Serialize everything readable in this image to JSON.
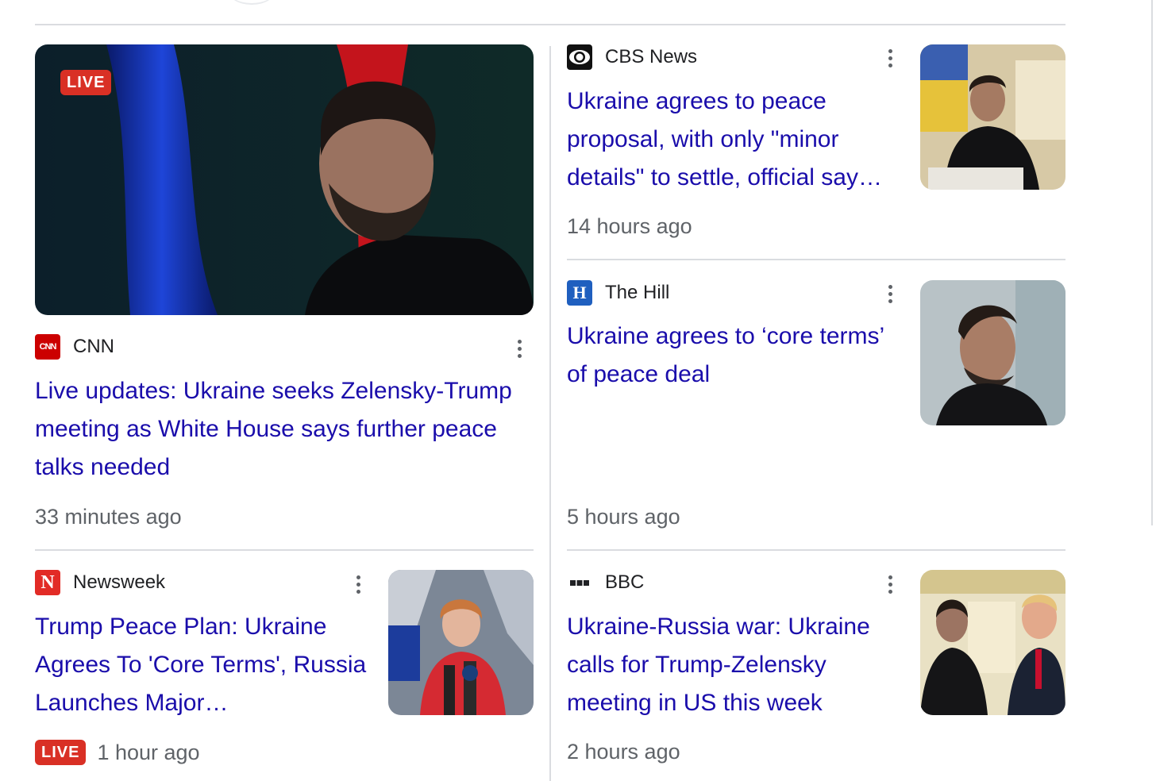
{
  "badges": {
    "live": "LIVE"
  },
  "colors": {
    "link": "#1a0dab",
    "meta": "#5f6368",
    "live": "#d93025",
    "divider": "#dadce0"
  },
  "articles": [
    {
      "source": "CNN",
      "source_icon": "cnn-logo",
      "headline": "Live updates: Ukraine seeks Zelensky-Trump meeting as White House says further peace talks needed",
      "time": "33 minutes ago",
      "thumb_badge": "LIVE"
    },
    {
      "source": "CBS News",
      "source_icon": "cbs-eye-logo",
      "headline": "Ukraine agrees to peace proposal, with only \"minor details\" to settle, official say…",
      "time": "14 hours ago"
    },
    {
      "source": "The Hill",
      "source_icon": "the-hill-logo",
      "headline": "Ukraine agrees to ‘core terms’ of peace deal",
      "time": "5 hours ago"
    },
    {
      "source": "Newsweek",
      "source_icon": "newsweek-logo",
      "headline": "Trump Peace Plan: Ukraine Agrees To 'Core Terms', Russia Launches Major…",
      "time": "1 hour ago",
      "time_badge": "LIVE"
    },
    {
      "source": "BBC",
      "source_icon": "bbc-logo",
      "headline": "Ukraine-Russia war: Ukraine calls for Trump-Zelensky meeting in US this week",
      "time": "2 hours ago"
    }
  ]
}
